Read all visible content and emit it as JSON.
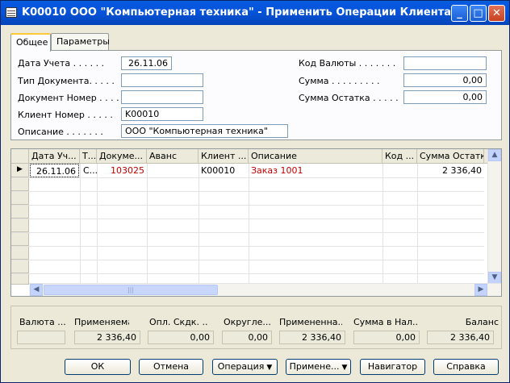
{
  "window": {
    "title": "K00010 ООО \"Компьютерная техника\" - Применить Операции Клиента"
  },
  "titlebar_buttons": {
    "minimize": "_",
    "maximize": "□",
    "close": "✕"
  },
  "tabs": [
    {
      "label": "Общее"
    },
    {
      "label": "Параметры"
    }
  ],
  "general": {
    "posting_date_label": "Дата Учета . . . . . .",
    "posting_date_value": "26.11.06",
    "doc_type_label": "Тип Документа. . . . .",
    "doc_type_value": "",
    "doc_no_label": "Документ Номер . . . .",
    "doc_no_value": "",
    "customer_no_label": "Клиент Номер . . . . .",
    "customer_no_value": "K00010",
    "description_label": "Описание . . . . . . .",
    "description_value": "ООО \"Компьютерная техника\"",
    "currency_label": "Код Валюты . . . . . . .",
    "currency_value": "",
    "amount_label": "Сумма . . . . . . . . .",
    "amount_value": "0,00",
    "remaining_label": "Сумма Остатка . . . . .",
    "remaining_value": "0,00"
  },
  "grid": {
    "columns": [
      "Дата Уч...",
      "Т...",
      "Докуме...",
      "Аванс",
      "Клиент ...",
      "Описание",
      "Код ...",
      "Сумма Остатка"
    ],
    "rows": [
      {
        "date": "26.11.06",
        "type": "С...",
        "doc": "103025",
        "advance": "",
        "customer": "K00010",
        "description": "Заказ 1001",
        "code": "",
        "remaining": "2 336,40"
      }
    ]
  },
  "totals": {
    "labels": [
      "Валюта ...",
      "Применяема...",
      "Опл. Скдк. ...",
      "Округле...",
      "Примененна...",
      "Сумма в Нал...",
      "Баланс"
    ],
    "values": [
      "",
      "2 336,40",
      "0,00",
      "0,00",
      "2 336,40",
      "0,00",
      "2 336,40"
    ]
  },
  "buttons": {
    "ok": "ОК",
    "cancel": "Отмена",
    "operation": "Операция",
    "apply": "Примене...",
    "navigator": "Навигатор",
    "help": "Справка"
  }
}
